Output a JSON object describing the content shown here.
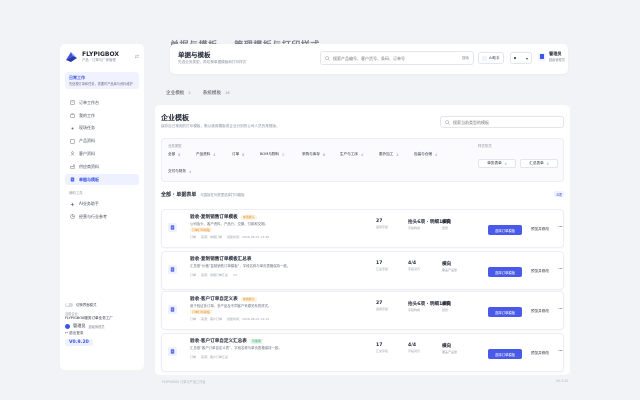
{
  "ghost_title": "单据与模板 — 管理模板与打印样式",
  "sidebar": {
    "brand": "FLYPIGBOX",
    "brand_sub": "产品 · 订单与厂家管理",
    "hint_title": "日常工作",
    "hint_text": "先处理订单和任务，需要时产品库与资料维护",
    "items": [
      {
        "label": "订单工作台",
        "icon": "order-icon"
      },
      {
        "label": "我的工作",
        "icon": "briefcase-icon"
      },
      {
        "label": "现场任务",
        "icon": "dot-icon"
      },
      {
        "label": "产品资料",
        "icon": "box-icon"
      },
      {
        "label": "客户资料",
        "icon": "user-icon"
      },
      {
        "label": "供应商资料",
        "icon": "factory-icon"
      },
      {
        "label": "单据与模板",
        "icon": "document-icon"
      }
    ],
    "group_label": "辅助工具",
    "tools": [
      {
        "label": "AI业务助手",
        "icon": "ai-icon"
      },
      {
        "label": "经营与行业参考",
        "icon": "chart-icon"
      }
    ],
    "toggle_label": "切换界面模式",
    "org_label": "当前企业",
    "org_name": "FLYPIGBOX服务订单业务工厂",
    "user_name": "管理员",
    "user_role": "超级管理员",
    "logout": "退出登录",
    "version": "V0.9.20"
  },
  "header": {
    "title": "单据与模板",
    "subtitle": "先选业务类型，再切换单据模板和打印样式",
    "search_placeholder": "搜索产品编号、客户货号、条码、订单号",
    "search_btn": "搜索",
    "pill1": "AI助手",
    "pill2": "",
    "user_name": "管理员",
    "user_role": "超级管理员"
  },
  "tabs": [
    {
      "label": "企业模板",
      "count": "2"
    },
    {
      "label": "系统模板",
      "count": "16"
    }
  ],
  "main": {
    "title": "企业模板",
    "subtitle": "保存自己常用的打印模板，默认使用模板或企业分到的公司人员的常规版。",
    "search_placeholder": "搜索当前类型的模板",
    "filter_label": "业务类型",
    "chips_row1": [
      {
        "label": "全部",
        "count": "8"
      },
      {
        "label": "产品资料",
        "count": "4"
      },
      {
        "label": "订单",
        "count": "8"
      },
      {
        "label": "BOM与物料",
        "count": "2"
      },
      {
        "label": "采购与库存",
        "count": "8"
      },
      {
        "label": "生产与工序",
        "count": "4"
      },
      {
        "label": "委外加工",
        "count": "4"
      },
      {
        "label": "包装与仓储",
        "count": "4"
      }
    ],
    "chips_row2": [
      {
        "label": "交付与财务",
        "count": "4"
      }
    ],
    "style_label": "样式形式",
    "style_btns": [
      {
        "label": "单张表单",
        "count": "4"
      },
      {
        "label": "汇总表单",
        "count": "4"
      }
    ],
    "section_title": "全部 · 单据表单",
    "section_hint": "可直接在列表里选择打印模板",
    "section_count": "8项",
    "rows": [
      {
        "title": "验收·复制销售订单模板",
        "badge": "常用默认",
        "badge_type": "orange",
        "desc": "公司抬头、客户资料、产品行、交期、付款和交期。",
        "tag": "订单打印模板",
        "meta": [
          "订单",
          "来源：常规订单",
          "创建时间：2026-06-01 13:28"
        ],
        "stat1_v": "27",
        "stat1_l": "适用字段",
        "stat2_v": "抬头6项 · 明细18项",
        "stat2_l": "字段构成",
        "stat3_v": "横向",
        "stat3_l": "纸张",
        "primary": "选择订单模板",
        "link": "预览并修改",
        "more": "···"
      },
      {
        "title": "验收·复制销售订单模板汇总表",
        "badge": "",
        "badge_type": "",
        "desc": "汇总按“价格”复制销售订单模板”，字段名称与单页表格保持一致。",
        "tag": "",
        "meta": [
          "订单",
          "来源：常规订单汇总",
          "V2"
        ],
        "stat1_v": "17",
        "stat1_l": "汇总字段",
        "stat2_v": "4/4",
        "stat2_l": "字段对齐",
        "stat3_v": "横向",
        "stat3_l": "覆盖产品量",
        "primary": "选择订单模板",
        "link": "预览并修改",
        "more": "···"
      },
      {
        "title": "验收·客户订单自定义表",
        "badge": "常用默认",
        "badge_type": "orange",
        "desc": "用于验证多订单、多产品及不同客户来源关系的样式。",
        "tag": "订单打印模板",
        "meta": [
          "订单",
          "来源：客户订单",
          "创建时间：2026-06-01 14:14"
        ],
        "stat1_v": "27",
        "stat1_l": "适用字段",
        "stat2_v": "抬头6项 · 明细18项",
        "stat2_l": "字段构成",
        "stat3_v": "横向",
        "stat3_l": "纸张",
        "primary": "选择订单模板",
        "link": "预览并修改",
        "more": "···"
      },
      {
        "title": "验收·客户订单自定义汇总表",
        "badge": "可使用",
        "badge_type": "green",
        "desc": "汇总按“客户订单自定义表”，字段名称与单页表格保持一致。",
        "tag": "",
        "meta": [
          "订单",
          "来源：客户订单汇总"
        ],
        "stat1_v": "17",
        "stat1_l": "汇总字段",
        "stat2_v": "4/4",
        "stat2_l": "字段对齐",
        "stat3_v": "横向",
        "stat3_l": "覆盖产品量",
        "primary": "选择订单模板",
        "link": "预览并修改",
        "more": "···"
      }
    ]
  },
  "footer_left": "FLYPIGBOX 订单与产品工作台",
  "footer_right": "V0.9.20",
  "colors": {
    "accent": "#4a5ae8",
    "active_bg": "#eef1ff",
    "orange": "#e08a1e",
    "green": "#2a9d5b"
  }
}
